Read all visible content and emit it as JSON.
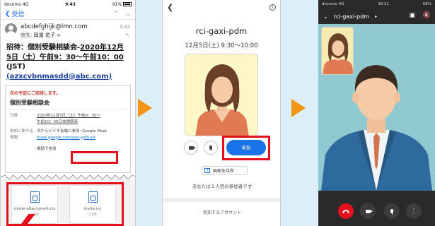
{
  "phone1": {
    "status": {
      "carrier": "docomo 4G",
      "time": "9:43",
      "battery": "91%"
    },
    "nav": {
      "back_label": "受信",
      "prev_icon": "chevron-up-icon",
      "next_icon": "chevron-down-icon"
    },
    "header": {
      "from": "abcdefghijk@lmn.com",
      "to_prefix": "宛先:",
      "to_name": "岡運 花子 >",
      "time": "9:42"
    },
    "subject": {
      "line1_a": "招待：個別受験相談会-",
      "line1_b": "2020年12月",
      "line2_a": "5日（土）午前9：30〜午前10：00",
      "line3": "(JST)",
      "line4": "(azxcvbnmasdd@abc.com)"
    },
    "card": {
      "invite_line": "次の予定にご招待します。",
      "event_title": "個別受験相談会",
      "date_key": "日時",
      "date_val_1": "2020年12月5日（土）午前9：30〜",
      "date_val_2": "午前10：00日本標準時",
      "join_key": "参加に関する情報",
      "join_val_1": "次からビデオ会議に参加: Google",
      "join_val_2": "Meet",
      "join_link": "meet.google.com/eez-ypfb-xit",
      "phone_label": "電話で参加"
    },
    "attachments": [
      {
        "name": "mime-attachment.ics",
        "size": "2 KB"
      },
      {
        "name": "invite.ics",
        "size": "2 KB"
      }
    ]
  },
  "phone2": {
    "nav": {
      "back_icon": "chevron-left-icon",
      "info_icon": "info-icon"
    },
    "meeting_title": "rci-gaxi-pdm",
    "meeting_time": "12月5日(土) 9:30〜10:00",
    "join_label": "参加",
    "share_label": "画面を共有",
    "first_participant": "あなたは１人目の参加者です",
    "account_label": "参加するアカウント"
  },
  "phone3": {
    "status": {
      "carrier": "docomo 4G",
      "time": "16:21",
      "battery": "68%"
    },
    "meeting_title": "rci-gaxi-pdm",
    "controls": [
      "hang-up",
      "camera",
      "microphone",
      "more"
    ]
  },
  "colors": {
    "highlight": "#e4101b",
    "arrow": "#f39419",
    "accent": "#1a73e8"
  }
}
